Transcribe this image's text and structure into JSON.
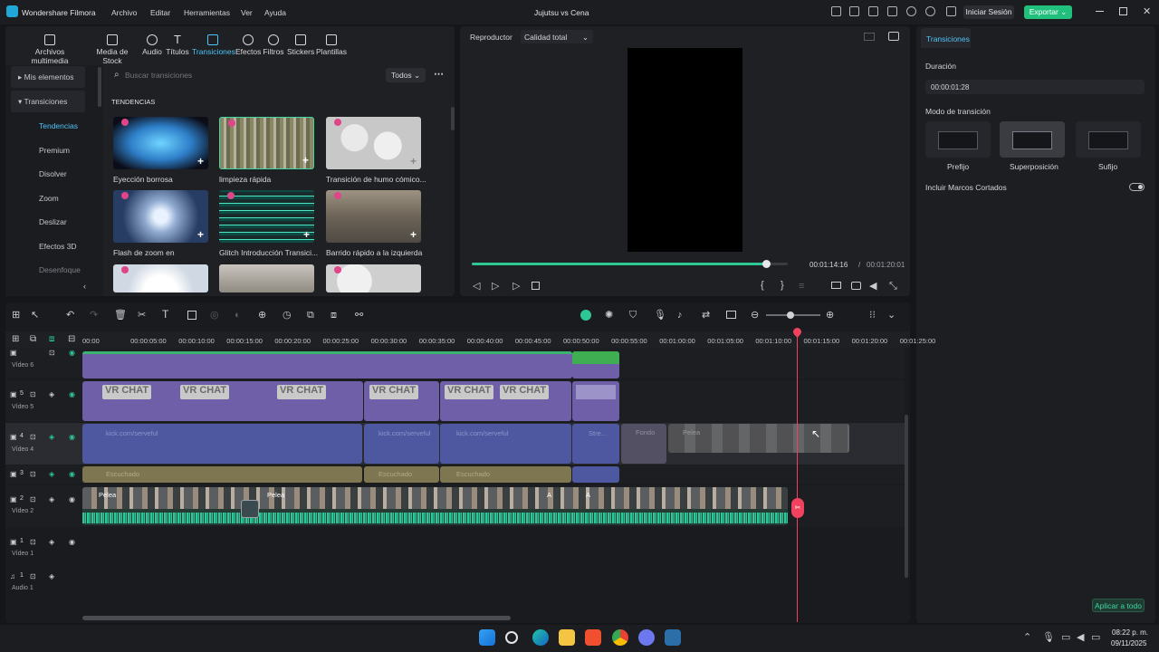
{
  "app": {
    "name": "Wondershare Filmora",
    "project_title": "Jujutsu vs Cena",
    "menu": [
      "Archivo",
      "Editar",
      "Herramientas",
      "Ver",
      "Ayuda"
    ],
    "login_button": "Iniciar Sesión",
    "export_button": "Exportar"
  },
  "toolbar": {
    "tabs": [
      "Archivos multimedia",
      "Media de Stock",
      "Audio",
      "Títulos",
      "Transiciones",
      "Efectos",
      "Filtros",
      "Stickers",
      "Plantillas"
    ],
    "active_tab": "Transiciones"
  },
  "sidebar": {
    "my_elements": "Mis elementos",
    "transitions": "Transiciones",
    "items": [
      "Tendencias",
      "Premium",
      "Disolver",
      "Zoom",
      "Deslizar",
      "Efectos 3D",
      "Desenfoque"
    ]
  },
  "browser": {
    "search_placeholder": "Buscar transiciones",
    "filter": "Todos",
    "section_title": "TENDENCIAS",
    "items": [
      {
        "name": "Eyección borrosa"
      },
      {
        "name": "limpieza rápida"
      },
      {
        "name": "Transición de humo cómico..."
      },
      {
        "name": "Flash de zoom en"
      },
      {
        "name": "Glitch Introducción Transici..."
      },
      {
        "name": "Barrido rápido a la izquierda"
      },
      {
        "name": ""
      },
      {
        "name": ""
      },
      {
        "name": ""
      }
    ]
  },
  "player": {
    "label": "Reproductor",
    "quality": "Calidad total",
    "current_time": "00:01:14:16",
    "separator": "/",
    "total_time": "00:01:20:01",
    "progress": 0.93
  },
  "properties": {
    "tab": "Transiciones",
    "duration_label": "Duración",
    "duration_value": "00:00:01:28",
    "mode_label": "Modo de transición",
    "modes": [
      "Prefijo",
      "Superposición",
      "Sufijo"
    ],
    "selected_mode": "Superposición",
    "include_short_frames": "Incluir Marcos Cortados",
    "apply_all": "Aplicar a todo"
  },
  "timeline": {
    "ruler": [
      "00:00",
      "00:00:05:00",
      "00:00:10:00",
      "00:00:15:00",
      "00:00:20:00",
      "00:00:25:00",
      "00:00:30:00",
      "00:00:35:00",
      "00:00:40:00",
      "00:00:45:00",
      "00:00:50:00",
      "00:00:55:00",
      "00:01:00:00",
      "00:01:05:00",
      "00:01:10:00",
      "00:01:15:00",
      "00:01:20:00",
      "00:01:25:00"
    ],
    "tracks": [
      {
        "number": "6",
        "name": "Vídeo 6"
      },
      {
        "number": "5",
        "name": "Vídeo 5"
      },
      {
        "number": "4",
        "name": "Vídeo 4"
      },
      {
        "number": "3",
        "name": ""
      },
      {
        "number": "2",
        "name": "Vídeo 2"
      },
      {
        "number": "1",
        "name": "Vídeo 1"
      },
      {
        "number": "1",
        "name": "Audio 1"
      }
    ],
    "vr_text": "VR CHAT",
    "kick_text": "kick.com/serveful",
    "subtitle_text": "Escuchado",
    "clip_labels": [
      "Pelea",
      "Pelea",
      "A",
      "A",
      "Pelea",
      "Fondo",
      "Stre..."
    ],
    "zoom_level": 0.45
  },
  "taskbar": {
    "time": "08:22 p. m.",
    "date": "09/11/2025"
  },
  "colors": {
    "accent": "#21c07c",
    "playhead": "#f0425f",
    "active_tab": "#4fc3f7",
    "audio_wave": "#2fc79a"
  }
}
